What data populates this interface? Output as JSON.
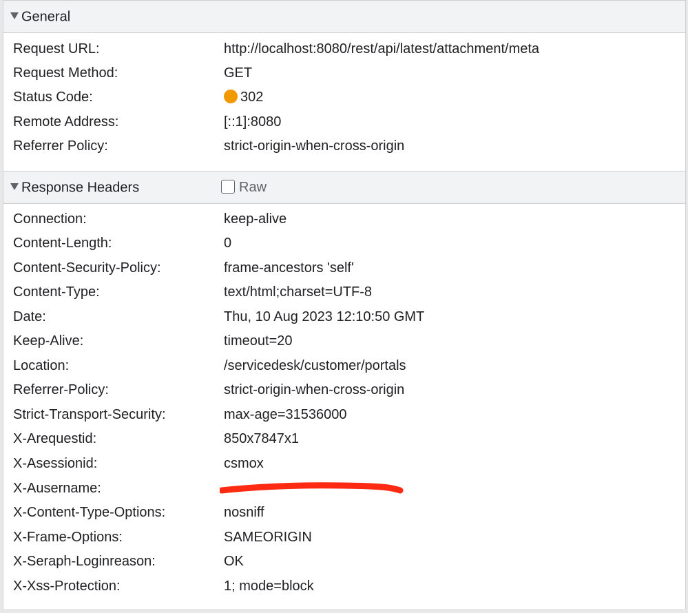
{
  "general": {
    "title": "General",
    "rows": [
      {
        "key": "Request URL:",
        "value": "http://localhost:8080/rest/api/latest/attachment/meta"
      },
      {
        "key": "Request Method:",
        "value": "GET"
      },
      {
        "key": "Status Code:",
        "value": "302"
      },
      {
        "key": "Remote Address:",
        "value": "[::1]:8080"
      },
      {
        "key": "Referrer Policy:",
        "value": "strict-origin-when-cross-origin"
      }
    ],
    "status_color": "#f29900"
  },
  "response_headers": {
    "title": "Response Headers",
    "raw_label": "Raw",
    "raw_checked": false,
    "rows": [
      {
        "key": "Connection:",
        "value": "keep-alive"
      },
      {
        "key": "Content-Length:",
        "value": "0"
      },
      {
        "key": "Content-Security-Policy:",
        "value": "frame-ancestors 'self'"
      },
      {
        "key": "Content-Type:",
        "value": "text/html;charset=UTF-8"
      },
      {
        "key": "Date:",
        "value": "Thu, 10 Aug 2023 12:10:50 GMT"
      },
      {
        "key": "Keep-Alive:",
        "value": "timeout=20"
      },
      {
        "key": "Location:",
        "value": "/servicedesk/customer/portals"
      },
      {
        "key": "Referrer-Policy:",
        "value": "strict-origin-when-cross-origin"
      },
      {
        "key": "Strict-Transport-Security:",
        "value": "max-age=31536000"
      },
      {
        "key": "X-Arequestid:",
        "value": "850x7847x1"
      },
      {
        "key": "X-Asessionid:",
        "value": "csmox"
      },
      {
        "key": "X-Ausername:",
        "value": ""
      },
      {
        "key": "X-Content-Type-Options:",
        "value": "nosniff"
      },
      {
        "key": "X-Frame-Options:",
        "value": "SAMEORIGIN"
      },
      {
        "key": "X-Seraph-Loginreason:",
        "value": "OK"
      },
      {
        "key": "X-Xss-Protection:",
        "value": "1; mode=block"
      }
    ],
    "redaction_color": "#ff2a12"
  }
}
